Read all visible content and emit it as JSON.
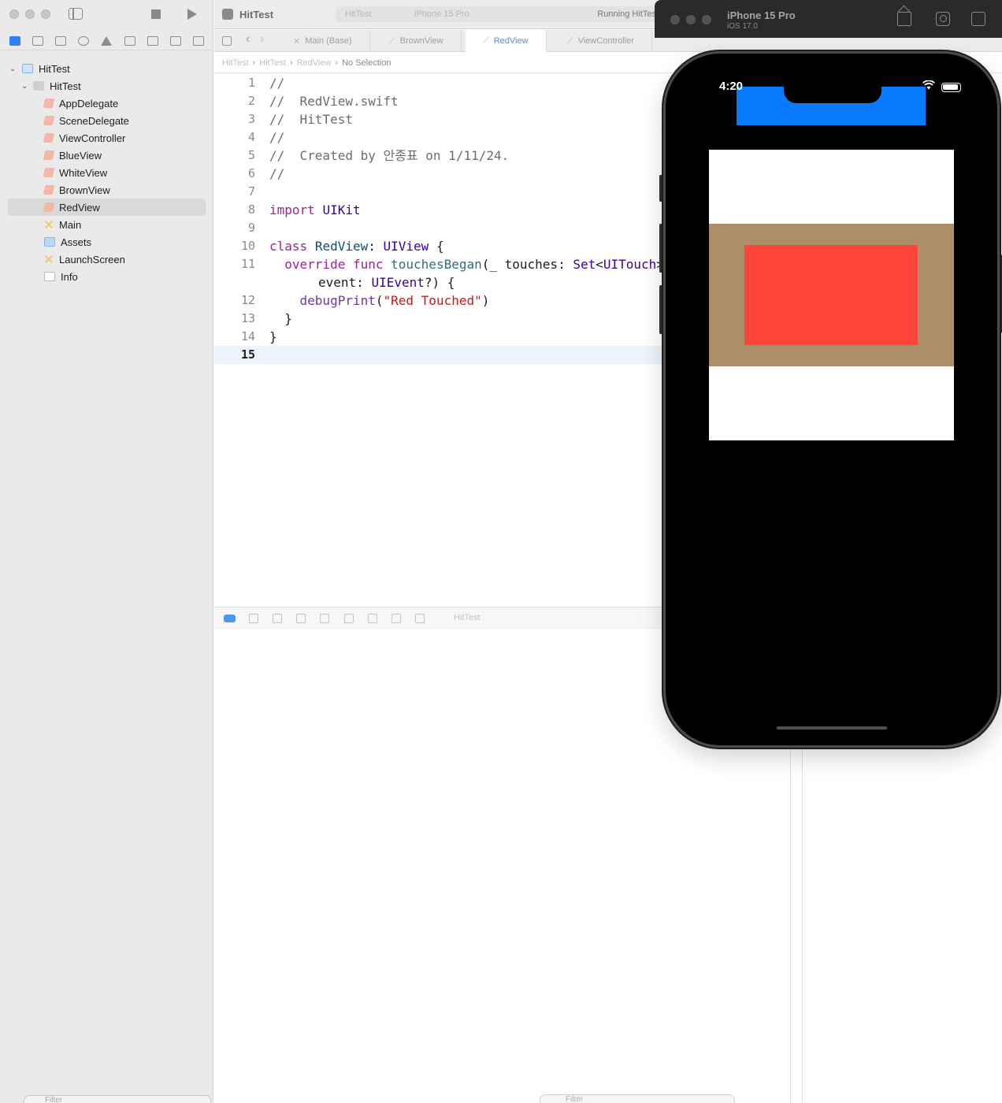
{
  "toolbar": {
    "app_title": "HitTest",
    "scheme": "HitTest",
    "device": "iPhone 15 Pro",
    "status": "Running HitTest"
  },
  "navigator": {
    "tree": [
      {
        "label": "HitTest",
        "level": 0,
        "icon": "project-icon",
        "expanded": true
      },
      {
        "label": "HitTest",
        "level": 1,
        "icon": "folder-icon",
        "expanded": true
      },
      {
        "label": "AppDelegate",
        "level": 2,
        "icon": "swift-file-icon"
      },
      {
        "label": "SceneDelegate",
        "level": 2,
        "icon": "swift-file-icon"
      },
      {
        "label": "ViewController",
        "level": 2,
        "icon": "swift-file-icon"
      },
      {
        "label": "BlueView",
        "level": 2,
        "icon": "swift-file-icon"
      },
      {
        "label": "WhiteView",
        "level": 2,
        "icon": "swift-file-icon"
      },
      {
        "label": "BrownView",
        "level": 2,
        "icon": "swift-file-icon"
      },
      {
        "label": "RedView",
        "level": 2,
        "icon": "swift-file-icon",
        "selected": true
      },
      {
        "label": "Main",
        "level": 2,
        "icon": "storyboard-icon"
      },
      {
        "label": "Assets",
        "level": 2,
        "icon": "assets-icon"
      },
      {
        "label": "LaunchScreen",
        "level": 2,
        "icon": "storyboard-icon"
      },
      {
        "label": "Info",
        "level": 2,
        "icon": "plist-icon"
      }
    ],
    "filter_placeholder": "Filter"
  },
  "tabs": [
    {
      "label": "Main (Base)",
      "active": false
    },
    {
      "label": "BrownView",
      "active": false
    },
    {
      "label": "RedView",
      "active": true
    },
    {
      "label": "ViewController",
      "active": false
    }
  ],
  "breadcrumb": [
    "HitTest",
    "HitTest",
    "RedView",
    "No Selection"
  ],
  "code": {
    "lines": [
      {
        "n": "1",
        "text": "//"
      },
      {
        "n": "2",
        "text": "//  RedView.swift"
      },
      {
        "n": "3",
        "text": "//  HitTest"
      },
      {
        "n": "4",
        "text": "//"
      },
      {
        "n": "5",
        "text": "//  Created by 안종표 on 1/11/24."
      },
      {
        "n": "6",
        "text": "//"
      },
      {
        "n": "7",
        "text": ""
      },
      {
        "n": "8",
        "text": "import UIKit"
      },
      {
        "n": "9",
        "text": ""
      },
      {
        "n": "10",
        "text": "class RedView: UIView {"
      },
      {
        "n": "11",
        "text": "  override func touchesBegan(_ touches: Set<UITouch>, with event: UIEvent?) {"
      },
      {
        "n": "12",
        "text": "    debugPrint(\"Red Touched\")"
      },
      {
        "n": "13",
        "text": "  }"
      },
      {
        "n": "14",
        "text": "}"
      },
      {
        "n": "15",
        "text": ""
      }
    ],
    "current_line": "15",
    "line11_wrap": "event: UIEvent?) {"
  },
  "debug": {
    "process": "HitTest",
    "filter_placeholder": "Filter"
  },
  "simulator": {
    "device_name": "iPhone 15 Pro",
    "os": "iOS 17.0",
    "status_time": "4:20",
    "colors": {
      "blue_view": "#0a7aff",
      "white_view": "#ffffff",
      "brown_view": "#ac8e68",
      "red_view": "#ff453a"
    }
  }
}
